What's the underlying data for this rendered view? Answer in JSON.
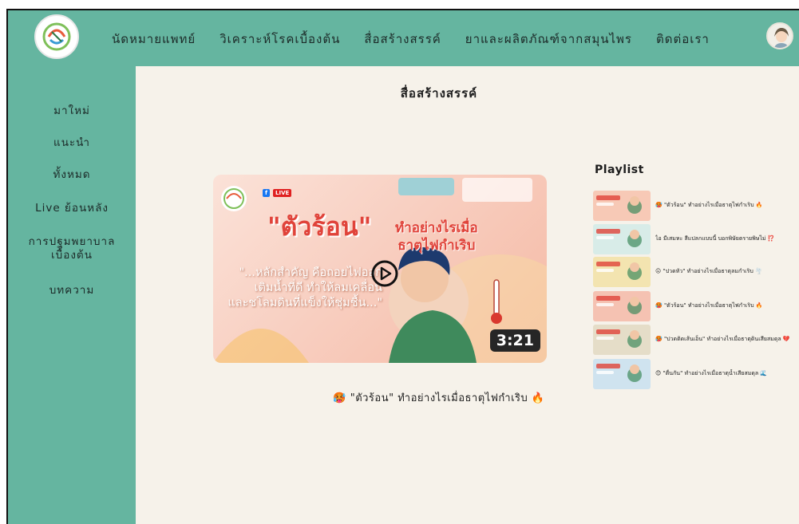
{
  "header": {
    "nav": [
      {
        "label": "นัดหมายแพทย์"
      },
      {
        "label": "วิเคราะห์โรคเบื้องต้น"
      },
      {
        "label": "สื่อสร้างสรรค์"
      },
      {
        "label": "ยาและผลิตภัณฑ์จากสมุนไพร"
      },
      {
        "label": "ติดต่อเรา"
      }
    ],
    "logo_icon": "logo-icon",
    "avatar_icon": "user-avatar-icon"
  },
  "sidebar": {
    "items": [
      {
        "label": "มาใหม่"
      },
      {
        "label": "แนะนำ"
      },
      {
        "label": "ทั้งหมด"
      },
      {
        "label": "Live ย้อนหลัง"
      },
      {
        "label": "การปฐมพยาบาล\nเบื้องต้น"
      },
      {
        "label": "บทความ"
      }
    ]
  },
  "main": {
    "title": "สื่อสร้างสรรค์",
    "video": {
      "thumb_headline": "\"ตัวร้อน\"",
      "thumb_subheadline": "ทำอย่างไรเมื่อ\nธาตุไฟกำเริบ",
      "thumb_quote": "\"...หลักสำคัญ คือถอยไฟออก\nเติมน้ำที่ดี ทำให้ลมเคลื่อน\nและชโลมดินที่แข็งให้ชุ่มชื้น...\"",
      "live_badge": "LIVE",
      "duration": "3:21",
      "caption": "🥵 \"ตัวร้อน\" ทำอย่างไรเมื่อธาตุไฟกำเริบ 🔥"
    },
    "playlist": {
      "title": "Playlist",
      "items": [
        {
          "title": "🥵 \"ตัวร้อน\" ทำอย่างไรเมื่อธาตุไฟกำเริบ 🔥",
          "thumb_color": "#f7c9b6"
        },
        {
          "title": "ไอ มีเสมหะ สีแปลกแบบนี้ บอกพิษัยตรายพิษไม่ ⁉️",
          "thumb_color": "#d8ece8"
        },
        {
          "title": "😖 \"ปวดหัว\" ทำอย่างไรเมื่อธาตุลมกำเริบ 🌪️",
          "thumb_color": "#f3e4b0"
        },
        {
          "title": "🥵 \"ตัวร้อน\" ทำอย่างไรเมื่อธาตุไฟกำเริบ 🔥",
          "thumb_color": "#f5c2b2"
        },
        {
          "title": "🥵 \"ปวดติดเส้นเอ็น\" ทำอย่างไรเมื่อธาตุดินเสียสมดุล 💔",
          "thumb_color": "#e5ddc8"
        },
        {
          "title": "😊 \"ตื่นกัน\" ทำอย่างไรเมื่อธาตุน้ำเสียสมดุล 🌊",
          "thumb_color": "#cfe3ef"
        }
      ]
    }
  },
  "colors": {
    "sidebar_bg": "#65b5a0",
    "main_bg": "#f6f2ea",
    "accent_red": "#e0433a"
  }
}
